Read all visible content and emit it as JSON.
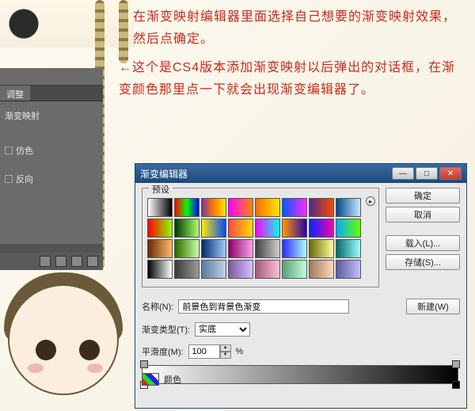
{
  "tutorial": {
    "line1": "在渐变映射编辑器里面选择自己想要的渐变映射效果，然后点确定。",
    "line2": "←这个是CS4版本添加渐变映射以后弹出的对话框，在渐变颜色那里点一下就会出现渐变编辑器了。"
  },
  "left_panel": {
    "tab1": "调整",
    "title": "渐变映射",
    "row_dither": "仿色",
    "row_reverse": "反向"
  },
  "dialog": {
    "title": "渐变编辑器",
    "presets_label": "预设",
    "buttons": {
      "ok": "确定",
      "cancel": "取消",
      "load": "载入(L)...",
      "save": "存储(S)...",
      "new": "新建(W)"
    },
    "name_label": "名称(N):",
    "name_value": "前景色到背景色渐变",
    "type_label": "渐变类型(T):",
    "type_value": "实底",
    "smooth_label": "平滑度(M):",
    "smooth_value": "100",
    "smooth_unit": "%",
    "color_label": "颜色"
  },
  "swatches": [
    "linear-gradient(90deg,#fff,#000)",
    "linear-gradient(90deg,#ff0000,#00ff00,#0000ff)",
    "linear-gradient(90deg,#7a3a9a,#ff7a00,#ffea00)",
    "linear-gradient(90deg,#ff00ff,#ff8800)",
    "linear-gradient(90deg,#ff6a00,#ffea00)",
    "linear-gradient(90deg,#005aff,#ff2aff)",
    "linear-gradient(90deg,#4a2a8a,#ff4a00)",
    "linear-gradient(90deg,#004a8a,#c8e8ff)",
    "linear-gradient(90deg,#ff0000,#8aff00)",
    "linear-gradient(90deg,#003a00,#aaff6a)",
    "linear-gradient(90deg,#ffea00,#004aff)",
    "linear-gradient(90deg,#ff4a4a,#ffda00)",
    "linear-gradient(90deg,#ff00ff,#00ffea)",
    "linear-gradient(90deg,#ff9a00,#2a00aa)",
    "linear-gradient(90deg,#002aff,#ff00aa)",
    "linear-gradient(90deg,#00aaff,#6aff00)",
    "linear-gradient(90deg,#6a2a00,#ffba6a)",
    "linear-gradient(90deg,#2a6a00,#caffa0)",
    "linear-gradient(90deg,#002a6a,#a0caff)",
    "linear-gradient(90deg,#8a006a,#ffa0ea)",
    "linear-gradient(90deg,#404040,#d0d0d0)",
    "linear-gradient(90deg,#2a2aff,#aaffff)",
    "linear-gradient(90deg,#6a6a00,#ffffa0)",
    "linear-gradient(90deg,#006a6a,#a0ffff)",
    "linear-gradient(90deg,#000,#fff)",
    "linear-gradient(90deg,#3a3a3a,#9a9a9a)",
    "linear-gradient(90deg,#5a7aa0,#c0d0e8)",
    "linear-gradient(90deg,#7a5aa0,#d8c0ff)",
    "linear-gradient(90deg,#a05a7a,#ffc0d8)",
    "linear-gradient(90deg,#5aa07a,#c0ffd8)",
    "linear-gradient(90deg,#a07a5a,#ffd8c0)",
    "linear-gradient(90deg,#5a5aa0,#c0c0ff)"
  ]
}
